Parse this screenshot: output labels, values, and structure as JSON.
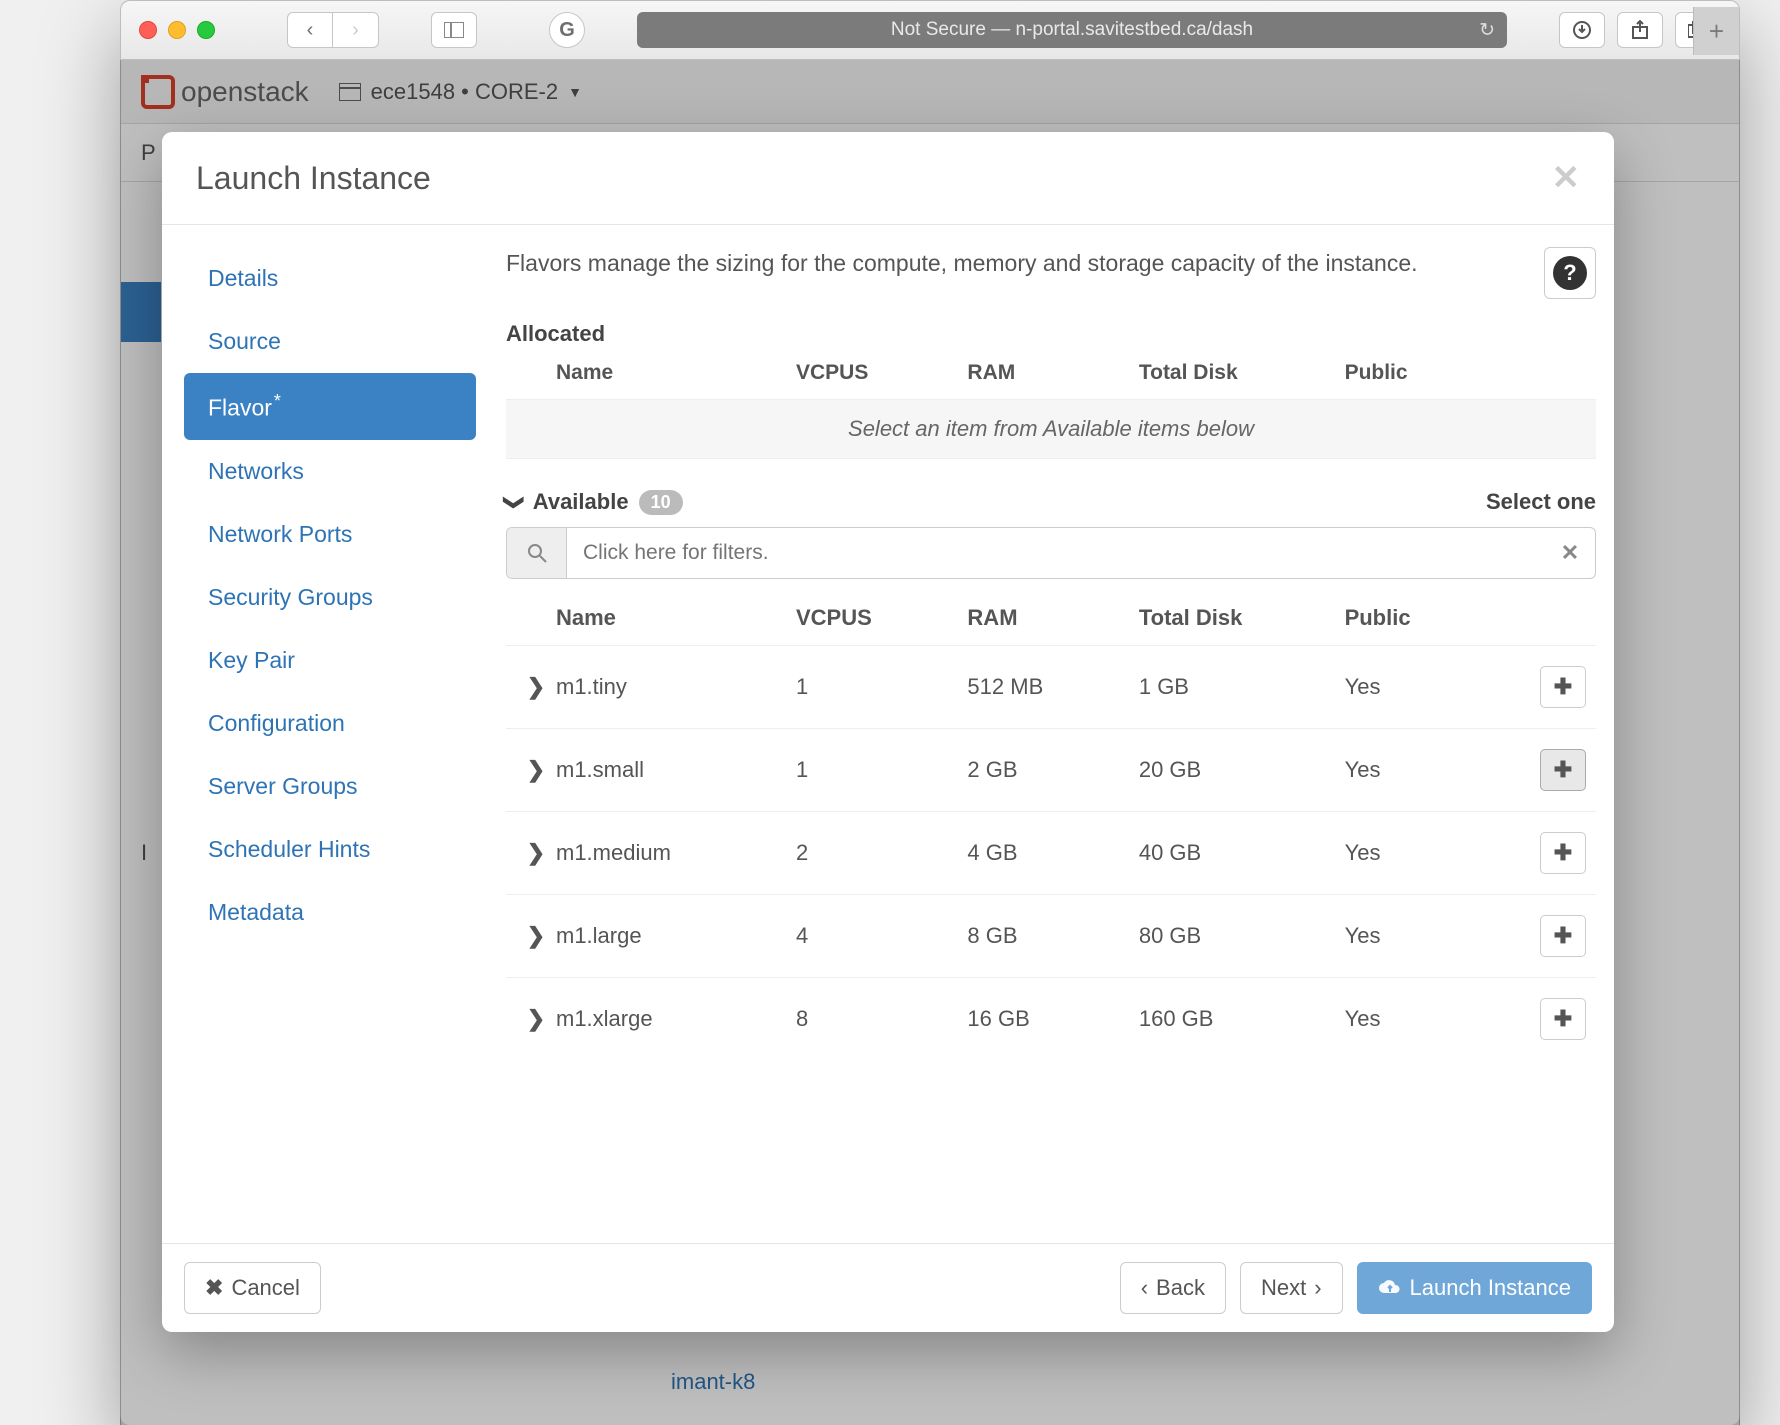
{
  "browser": {
    "url_display": "Not Secure — n-portal.savitestbed.ca/dash"
  },
  "background": {
    "logo_text": "openstack",
    "crumb": "ece1548 • CORE-2",
    "subnav_initial": "P",
    "side_initial": "I",
    "bg_link1": "imant-k8"
  },
  "modal": {
    "title": "Launch Instance",
    "description": "Flavors manage the sizing for the compute, memory and storage capacity of the instance.",
    "allocated_label": "Allocated",
    "alloc_placeholder": "Select an item from Available items below",
    "available_label": "Available",
    "available_count": "10",
    "select_one": "Select one",
    "filter_placeholder": "Click here for filters.",
    "columns": {
      "name": "Name",
      "vcpus": "VCPUS",
      "ram": "RAM",
      "disk": "Total Disk",
      "public": "Public"
    },
    "nav": {
      "details": "Details",
      "source": "Source",
      "flavor": "Flavor",
      "networks": "Networks",
      "net_ports": "Network Ports",
      "sec_groups": "Security Groups",
      "key_pair": "Key Pair",
      "configuration": "Configuration",
      "server_groups": "Server Groups",
      "scheduler": "Scheduler Hints",
      "metadata": "Metadata"
    },
    "flavors": [
      {
        "name": "m1.tiny",
        "vcpus": "1",
        "ram": "512 MB",
        "disk": "1 GB",
        "public": "Yes",
        "hover": false
      },
      {
        "name": "m1.small",
        "vcpus": "1",
        "ram": "2 GB",
        "disk": "20 GB",
        "public": "Yes",
        "hover": true
      },
      {
        "name": "m1.medium",
        "vcpus": "2",
        "ram": "4 GB",
        "disk": "40 GB",
        "public": "Yes",
        "hover": false
      },
      {
        "name": "m1.large",
        "vcpus": "4",
        "ram": "8 GB",
        "disk": "80 GB",
        "public": "Yes",
        "hover": false
      },
      {
        "name": "m1.xlarge",
        "vcpus": "8",
        "ram": "16 GB",
        "disk": "160 GB",
        "public": "Yes",
        "hover": false
      }
    ],
    "footer": {
      "cancel": "Cancel",
      "back": "Back",
      "next": "Next",
      "launch": "Launch Instance"
    },
    "glyphs": {
      "chev_left": "‹",
      "chev_right": "›",
      "times": "✕",
      "plus": "✚",
      "chev_down": "⌄"
    }
  }
}
